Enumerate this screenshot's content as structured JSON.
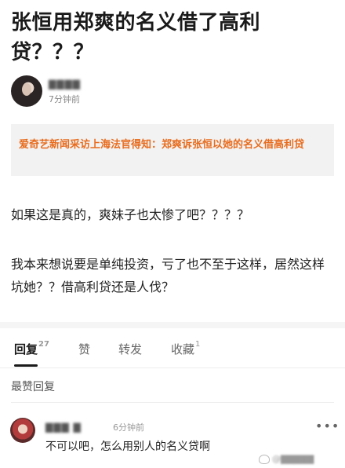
{
  "post": {
    "title": "张恒用郑爽的名义借了高利贷？？？",
    "author_name": "▇▇▇▇",
    "author_time": "7分钟前",
    "quote": "爱奇艺新闻采访上海法官得知：郑爽诉张恒以她的名义借高利贷",
    "paragraph1": "如果这是真的，爽妹子也太惨了吧？？？？",
    "paragraph2": "我本来想说要是单纯投资，亏了也不至于这样，居然这样坑她？？借高利贷还是人伐？"
  },
  "tabs": [
    {
      "label": "回复",
      "count": "27"
    },
    {
      "label": "赞",
      "count": ""
    },
    {
      "label": "转发",
      "count": ""
    },
    {
      "label": "收藏",
      "count": "1"
    }
  ],
  "comments_section": {
    "title": "最赞回复",
    "comment": {
      "user": "▇▇▇ ▇",
      "time": "6分钟前",
      "more": "•••",
      "text": "不可以吧，怎么用别人的名义贷啊"
    }
  },
  "watermark": {
    "handle": "@▇▇▇▇▇"
  }
}
